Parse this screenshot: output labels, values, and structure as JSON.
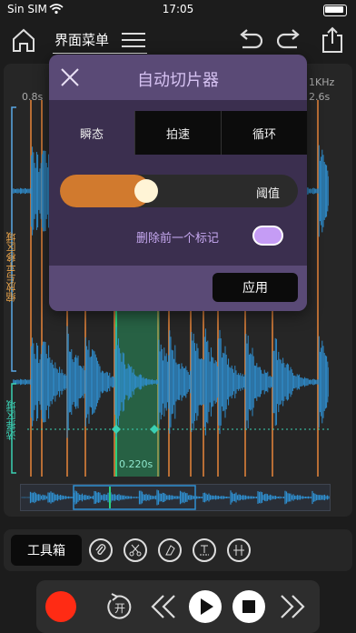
{
  "status": {
    "carrier": "Sin SIM",
    "time": "17:05"
  },
  "topbar": {
    "menu_label": "界面菜单"
  },
  "wave": {
    "time_start": "0.8s",
    "time_end": "2.6s",
    "freq_label": "1KHz",
    "zoom_label": "缩放与平移区域",
    "select_label": "选择区域",
    "selection_duration": "0.220s",
    "wave_color": "#2f8fd0",
    "marker_color": "#e9863a",
    "selection_color": "#2bd17e"
  },
  "dialog": {
    "title": "自动切片器",
    "tabs": [
      "瞬态",
      "拍速",
      "循环"
    ],
    "active_tab": 0,
    "slider_label": "阈值",
    "slider_level": 0.38,
    "toggle_label": "删除前一个标记",
    "toggle_on": true,
    "apply_label": "应用"
  },
  "toolbar": {
    "toolbox_label": "工具箱"
  },
  "transport": {
    "loop_label": "开"
  }
}
